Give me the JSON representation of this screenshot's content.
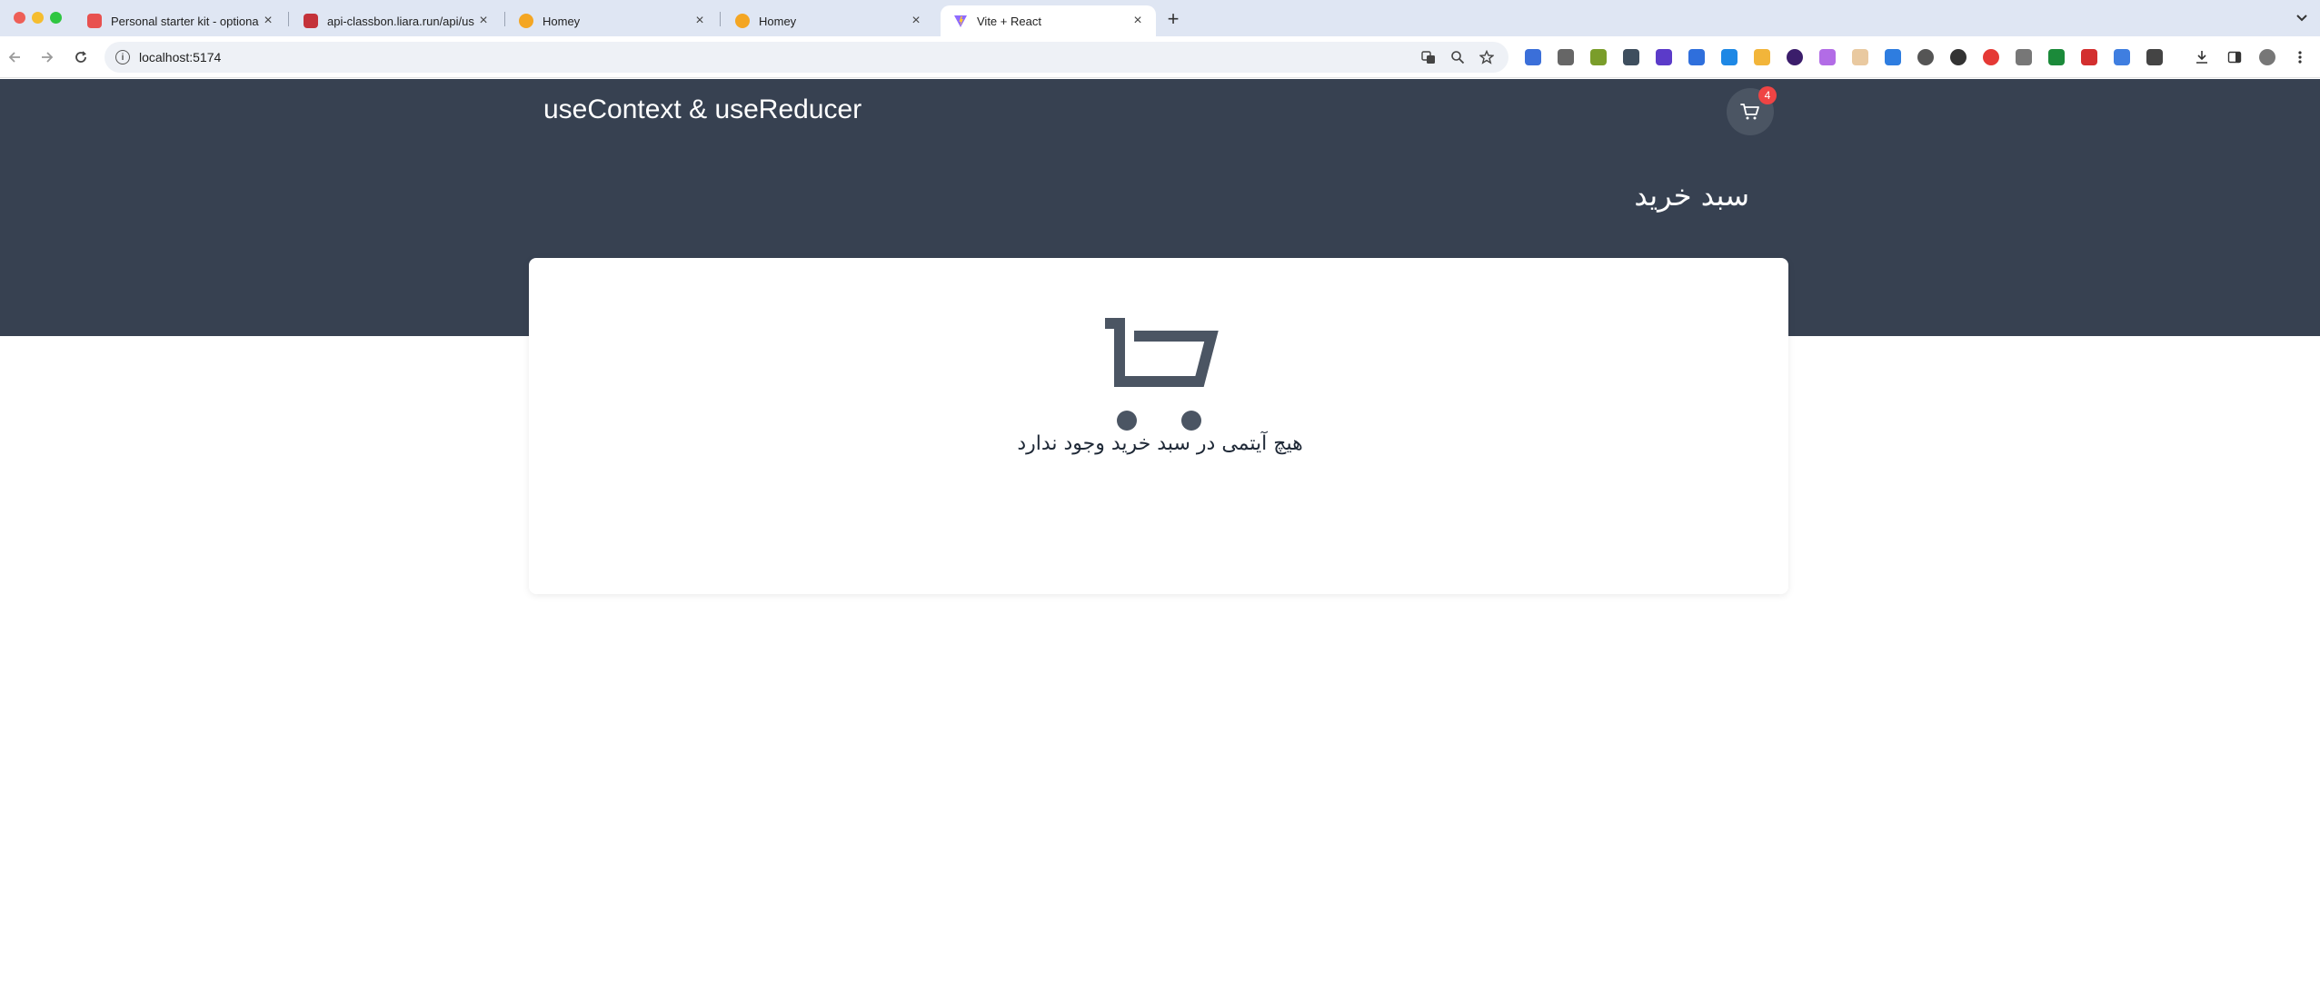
{
  "browser": {
    "tabs": [
      {
        "title": "Personal starter kit - optional",
        "favicon_color": "#e8514f",
        "active": false
      },
      {
        "title": "api-classbon.liara.run/api/use",
        "favicon_color": "#c4323a",
        "active": false
      },
      {
        "title": "Homey",
        "favicon_color": "#f4a623",
        "active": false
      },
      {
        "title": "Homey",
        "favicon_color": "#f4a623",
        "active": false
      },
      {
        "title": "Vite + React",
        "favicon_color": "#8f6bff",
        "active": true
      }
    ],
    "new_tab_label": "+",
    "close_label": "×",
    "address": "localhost:5174"
  },
  "header": {
    "app_title": "useContext & useReducer",
    "cart_count": "4"
  },
  "main": {
    "heading": "سبد خرید",
    "empty_message": "هیچ آیتمی در سبد خرید وجود ندارد"
  },
  "colors": {
    "header_bg": "#374151",
    "badge": "#ef4444",
    "icon": "#4b5563"
  }
}
